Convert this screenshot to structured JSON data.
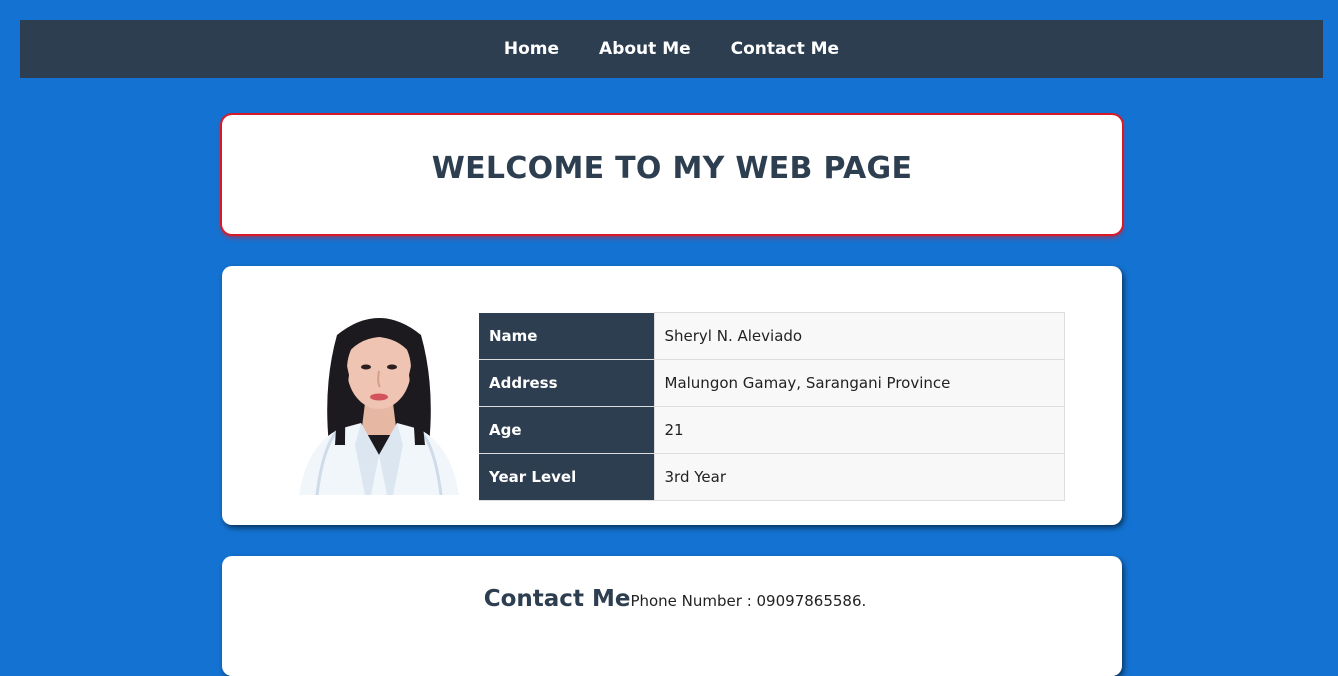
{
  "nav": {
    "items": [
      {
        "label": "Home"
      },
      {
        "label": "About Me"
      },
      {
        "label": "Contact Me"
      }
    ]
  },
  "welcome": {
    "title": "WELCOME TO MY WEB PAGE"
  },
  "profile": {
    "photo_icon": "profile-photo",
    "rows": [
      {
        "label": "Name",
        "value": "Sheryl N. Aleviado"
      },
      {
        "label": "Address",
        "value": "Malungon Gamay, Sarangani Province"
      },
      {
        "label": "Age",
        "value": "21"
      },
      {
        "label": "Year Level",
        "value": "3rd Year"
      }
    ]
  },
  "contact": {
    "heading": "Contact Me",
    "phone": "Phone Number : 09097865586."
  },
  "colors": {
    "background": "#1473d2",
    "nav": "#2d3e51",
    "header_cell": "#2d3e51",
    "welcome_border": "#d71a2a",
    "card": "#ffffff"
  }
}
